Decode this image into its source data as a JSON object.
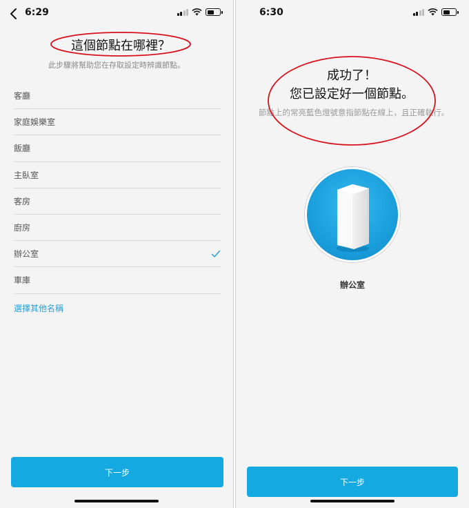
{
  "screen_left": {
    "status": {
      "time": "6:29"
    },
    "title": "這個節點在哪裡？",
    "subtitle": "此步驟將幫助您在存取設定時辨識節點。",
    "rooms": [
      {
        "label": "客廳"
      },
      {
        "label": "家庭娛樂室"
      },
      {
        "label": "飯廳"
      },
      {
        "label": "主臥室"
      },
      {
        "label": "客房"
      },
      {
        "label": "廚房"
      },
      {
        "label": "辦公室",
        "selected": true
      },
      {
        "label": "車庫"
      }
    ],
    "other_name_link": "選擇其他名稱",
    "next_button": "下一步"
  },
  "screen_right": {
    "status": {
      "time": "6:30"
    },
    "success_title": "成功了！",
    "success_message": "您已設定好一個節點。",
    "description": "節點上的常亮藍色燈號意指節點在線上，且正確執行。",
    "node_name": "辦公室",
    "next_button": "下一步"
  },
  "colors": {
    "accent": "#15a9e1",
    "link": "#2ba0d8",
    "annotation": "#d8101a",
    "background": "#f4f4f4"
  },
  "icons": {
    "back": "chevron-left-icon",
    "check": "checkmark-icon",
    "signal": "cellular-signal-icon",
    "wifi": "wifi-icon",
    "battery": "battery-icon",
    "node": "velop-node-icon"
  }
}
